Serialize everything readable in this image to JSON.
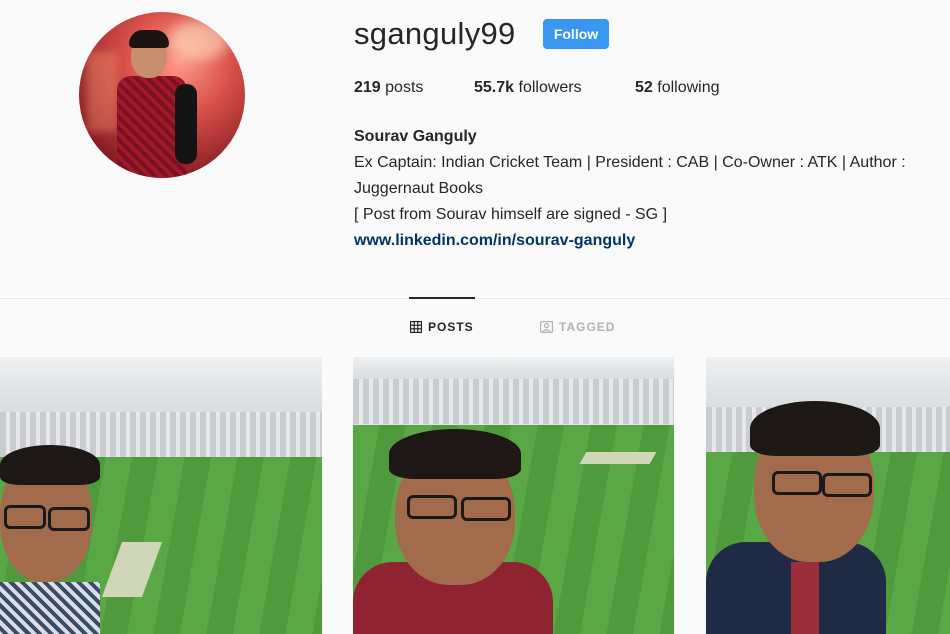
{
  "profile": {
    "username": "sganguly99",
    "follow_label": "Follow",
    "stats": {
      "posts_count": "219",
      "posts_label": " posts",
      "followers_count": "55.7k",
      "followers_label": " followers",
      "following_count": "52",
      "following_label": " following"
    },
    "bio": {
      "full_name": "Sourav Ganguly",
      "line1": "Ex Captain: Indian Cricket Team | President : CAB | Co-Owner : ATK | Author :",
      "line2": "Juggernaut Books",
      "line3": "[ Post from Sourav himself are signed - SG ]",
      "link": "www.linkedin.com/in/sourav-ganguly"
    }
  },
  "tabs": [
    {
      "label": "POSTS",
      "icon": "grid-icon",
      "active": true
    },
    {
      "label": "TAGGED",
      "icon": "tag-icon",
      "active": false
    }
  ],
  "colors": {
    "follow_button": "#3897f0",
    "link": "#003569",
    "background": "#fafafa"
  }
}
